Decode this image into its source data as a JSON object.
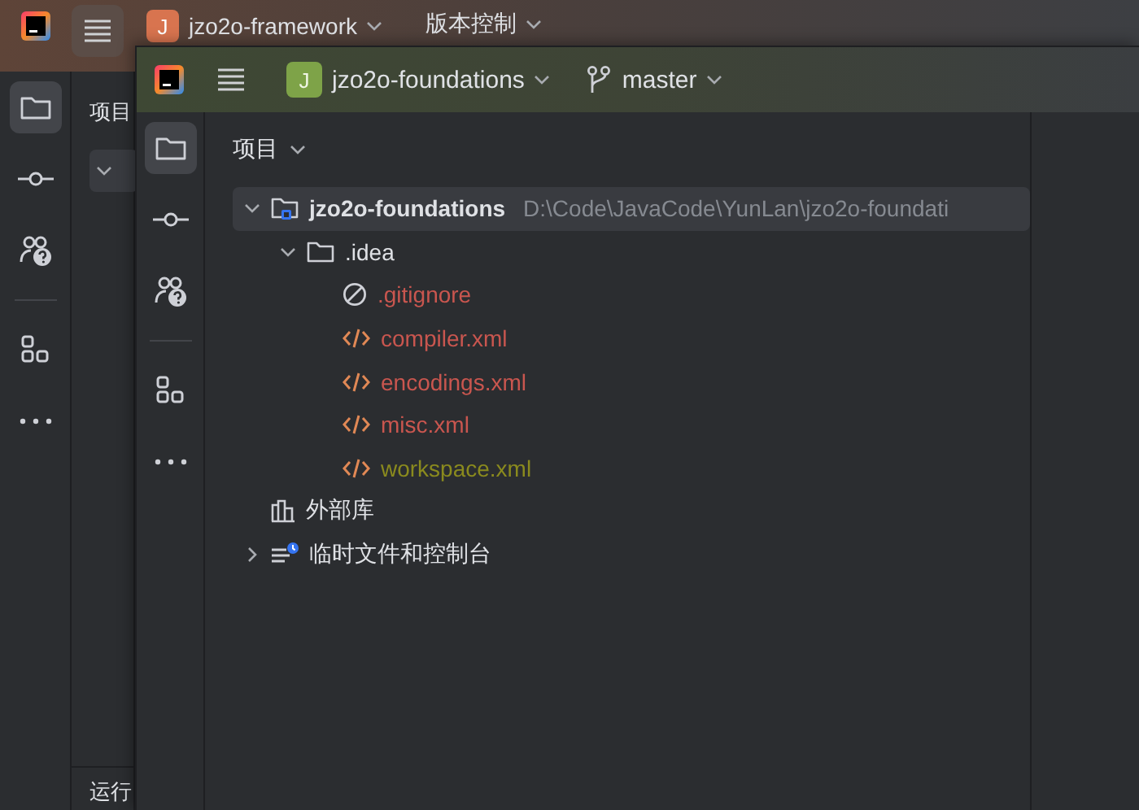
{
  "back_window": {
    "title_bar": {
      "project": {
        "avatar": "J",
        "name": "jzo2o-framework"
      },
      "vcs": "版本控制"
    },
    "toolbar": [
      {
        "kind": "folder",
        "selected": true
      },
      {
        "kind": "commit",
        "selected": false
      },
      {
        "kind": "people",
        "selected": false
      },
      {
        "kind": "divider"
      },
      {
        "kind": "structure",
        "selected": false
      },
      {
        "kind": "more",
        "selected": false
      }
    ],
    "project_panel": {
      "title": "项目"
    },
    "bottom_panel": {
      "title": "运行"
    }
  },
  "front_window": {
    "title_bar": {
      "project": {
        "avatar": "J",
        "name": "jzo2o-foundations"
      },
      "branch": "master"
    },
    "toolbar": [
      {
        "kind": "folder",
        "selected": true
      },
      {
        "kind": "commit",
        "selected": false
      },
      {
        "kind": "people",
        "selected": false
      },
      {
        "kind": "divider"
      },
      {
        "kind": "structure",
        "selected": false
      },
      {
        "kind": "more",
        "selected": false
      }
    ],
    "project_panel": {
      "title": "项目",
      "tree": [
        {
          "kind": "module",
          "name": "jzo2o-foundations",
          "path": "D:\\Code\\JavaCode\\YunLan\\jzo2o-foundati",
          "expanded": true,
          "selected": true,
          "children": [
            {
              "kind": "folder",
              "name": ".idea",
              "expanded": true,
              "selected": false,
              "children": [
                {
                  "kind": "ignore",
                  "name": ".gitignore",
                  "color": "#c9564f",
                  "selected": false
                },
                {
                  "kind": "xml",
                  "name": "compiler.xml",
                  "color": "#c9564f",
                  "selected": false
                },
                {
                  "kind": "xml",
                  "name": "encodings.xml",
                  "color": "#c9564f",
                  "selected": false
                },
                {
                  "kind": "xml",
                  "name": "misc.xml",
                  "color": "#c9564f",
                  "selected": false
                },
                {
                  "kind": "xml",
                  "name": "workspace.xml",
                  "color": "#8a8a1e",
                  "selected": false
                }
              ]
            }
          ]
        },
        {
          "kind": "library",
          "name": "外部库",
          "selected": false
        },
        {
          "kind": "scratch",
          "name": "临时文件和控制台",
          "expanded": false,
          "selected": false
        }
      ]
    }
  }
}
